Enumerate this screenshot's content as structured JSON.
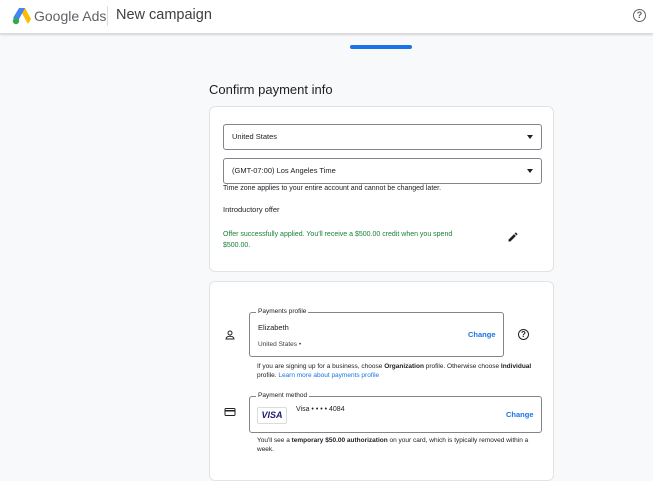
{
  "header": {
    "brand_google": "Google",
    "brand_ads": "Ads",
    "campaign_title": "New campaign"
  },
  "page_title": "Confirm payment info",
  "account_settings": {
    "country": "United States",
    "timezone": "(GMT-07:00) Los Angeles Time",
    "timezone_note": "Time zone applies to your entire account and cannot be changed later.",
    "intro_offer_label": "Introductory offer",
    "offer_line1": "Offer successfully applied. You'll receive a $500.00 credit when you spend",
    "offer_line2": "$500.00."
  },
  "payments_profile": {
    "legend": "Payments profile",
    "name": "Elizabeth",
    "country": "United States •",
    "change_label": "Change",
    "note_prefix": "If you are signing up for a business, choose ",
    "note_org": "Organization",
    "note_mid": " profile. Otherwise choose ",
    "note_individual": "Individual",
    "note_line2": "profile. ",
    "note_link": "Learn more about payments profile"
  },
  "payment_method": {
    "legend": "Payment method",
    "card_brand": "VISA",
    "card_text": "Visa • • • • 4084",
    "change_label": "Change",
    "note_prefix": "You'll see a ",
    "note_bold": "temporary $50.00 authorization",
    "note_suffix": " on your card, which is typically removed within a",
    "note_line2": "week."
  },
  "colors": {
    "accent": "#1a73e8",
    "success": "#188038"
  }
}
